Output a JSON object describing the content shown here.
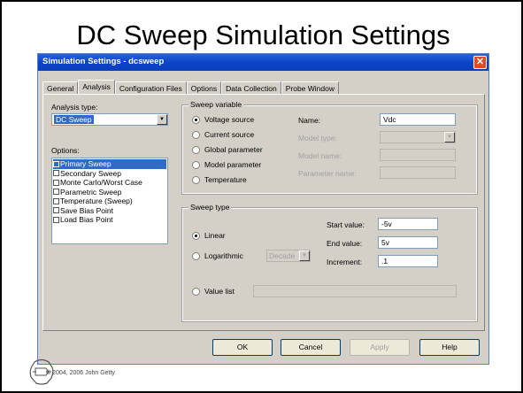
{
  "slide_title": "DC Sweep Simulation Settings",
  "dialog": {
    "title": "Simulation Settings - dcsweep",
    "close": "✕",
    "tabs": [
      "General",
      "Analysis",
      "Configuration Files",
      "Options",
      "Data Collection",
      "Probe Window"
    ],
    "active_tab": "Analysis",
    "analysis_type_label": "Analysis type:",
    "analysis_type_value": "DC Sweep",
    "options_label": "Options:",
    "options": [
      {
        "label": "Primary Sweep",
        "checked": true,
        "selected": true
      },
      {
        "label": "Secondary Sweep",
        "checked": false,
        "selected": false
      },
      {
        "label": "Monte Carlo/Worst Case",
        "checked": false,
        "selected": false
      },
      {
        "label": "Parametric Sweep",
        "checked": false,
        "selected": false
      },
      {
        "label": "Temperature (Sweep)",
        "checked": false,
        "selected": false
      },
      {
        "label": "Save Bias Point",
        "checked": false,
        "selected": false
      },
      {
        "label": "Load Bias Point",
        "checked": false,
        "selected": false
      }
    ],
    "sweep_variable": {
      "title": "Sweep variable",
      "radios": [
        "Voltage source",
        "Current source",
        "Global parameter",
        "Model parameter",
        "Temperature"
      ],
      "selected": "Voltage source",
      "name_label": "Name:",
      "name_value": "Vdc",
      "model_type_label": "Model type:",
      "model_name_label": "Model name:",
      "parameter_name_label": "Parameter name:"
    },
    "sweep_type": {
      "title": "Sweep type",
      "linear": "Linear",
      "logarithmic": "Logarithmic",
      "log_option": "Decade",
      "value_list": "Value list",
      "selected": "Linear",
      "start_label": "Start value:",
      "start_value": "-5v",
      "end_label": "End value:",
      "end_value": "5v",
      "increment_label": "Increment:",
      "increment_value": ".1"
    },
    "buttons": {
      "ok": "OK",
      "cancel": "Cancel",
      "apply": "Apply",
      "help": "Help"
    }
  },
  "footer": "© 2004, 2006 John Getty"
}
